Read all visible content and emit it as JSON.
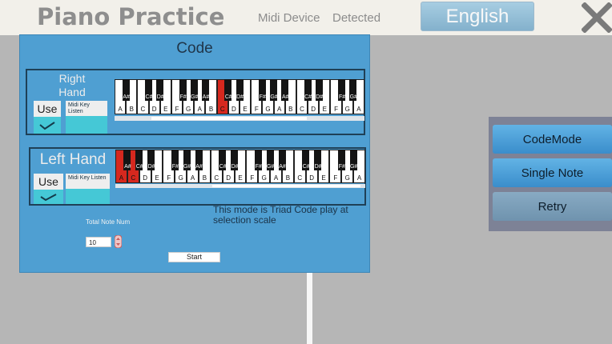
{
  "header": {
    "title": "Piano Practice",
    "midi_label": "Midi Device",
    "midi_status": "Detected",
    "language_button": "English"
  },
  "code_panel": {
    "title": "Code",
    "right_hand": {
      "label": "Right\nHand",
      "use_button": "Use",
      "use_checked": true,
      "midi_key_listen": "Midi Key Listen",
      "white_keys": [
        "A",
        "B",
        "C",
        "D",
        "E",
        "F",
        "G",
        "A",
        "B",
        "C",
        "D",
        "E",
        "F",
        "G",
        "A",
        "B",
        "C",
        "D",
        "E",
        "F",
        "G",
        "A"
      ],
      "black_keys": [
        "A#",
        "C#",
        "D#",
        "F#",
        "G#",
        "A#",
        "C#",
        "D#",
        "F#",
        "G#",
        "A#",
        "C#",
        "D#",
        "F#",
        "G#",
        "A#"
      ],
      "highlighted_keys": [
        9
      ]
    },
    "left_hand": {
      "label": "Left Hand",
      "use_button": "Use",
      "use_checked": true,
      "midi_key_listen": "Midi Key Listen",
      "white_keys": [
        "A",
        "C",
        "D",
        "E",
        "F",
        "G",
        "A",
        "B",
        "C",
        "D",
        "E",
        "F",
        "G",
        "A",
        "B",
        "C",
        "D",
        "E",
        "F",
        "G",
        "A"
      ],
      "black_keys": [
        "A#",
        "C#",
        "D#",
        "F#",
        "G#",
        "A#",
        "C#",
        "D#",
        "F#",
        "G#",
        "A#",
        "C#",
        "D#",
        "F#",
        "G#",
        "A#"
      ],
      "highlighted_keys": [
        0,
        1
      ]
    },
    "total_note_label": "Total Note Num",
    "total_note_value": "10",
    "mode_description": "This mode is Triad Code play at selection scale",
    "start_button": "Start"
  },
  "mode_menu": {
    "items": [
      {
        "label": "CodeMode",
        "active": true
      },
      {
        "label": "Single Note",
        "active": true
      },
      {
        "label": "Retry",
        "active": false
      }
    ]
  },
  "colors": {
    "panel": "#4f9fd2",
    "accent": "#45c8d6",
    "highlight_key": "#d6281e"
  },
  "icons": [
    "close-icon",
    "checkmark-icon",
    "stepper-icon"
  ]
}
